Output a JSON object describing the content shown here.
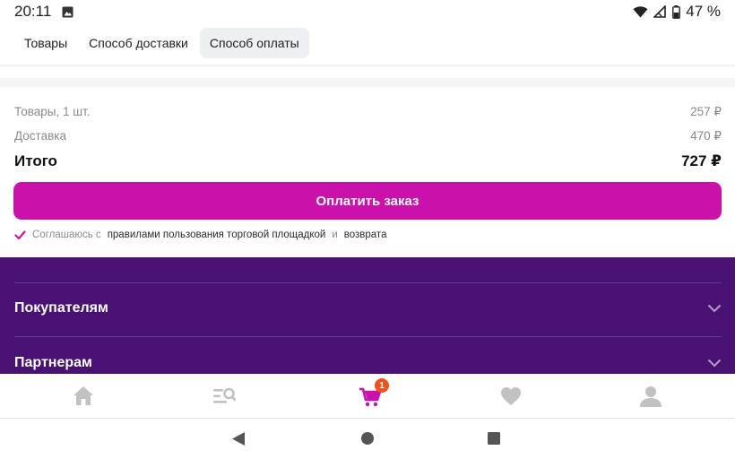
{
  "status_bar": {
    "time": "20:11",
    "battery": "47 %"
  },
  "tabs": [
    {
      "label": "Товары",
      "active": false
    },
    {
      "label": "Способ доставки",
      "active": false
    },
    {
      "label": "Способ оплаты",
      "active": true
    }
  ],
  "summary": {
    "goods_label": "Товары, 1 шт.",
    "goods_value": "257 ₽",
    "delivery_label": "Доставка",
    "delivery_value": "470 ₽",
    "total_label": "Итого",
    "total_value": "727 ₽"
  },
  "pay_button_label": "Оплатить заказ",
  "agreement": {
    "prefix": "Соглашаюсь с",
    "rules_link": "правилами пользования торговой площадкой",
    "conj": "и",
    "return_link": "возврата"
  },
  "footer": {
    "items": [
      {
        "label": "Покупателям"
      },
      {
        "label": "Партнерам"
      }
    ]
  },
  "bottom_nav": {
    "cart_badge": "1",
    "active_item": "cart"
  },
  "colors": {
    "accent": "#cb11ab",
    "footer_bg": "#481173",
    "badge": "#f5511d",
    "nav_inactive": "#c2c2c2"
  }
}
